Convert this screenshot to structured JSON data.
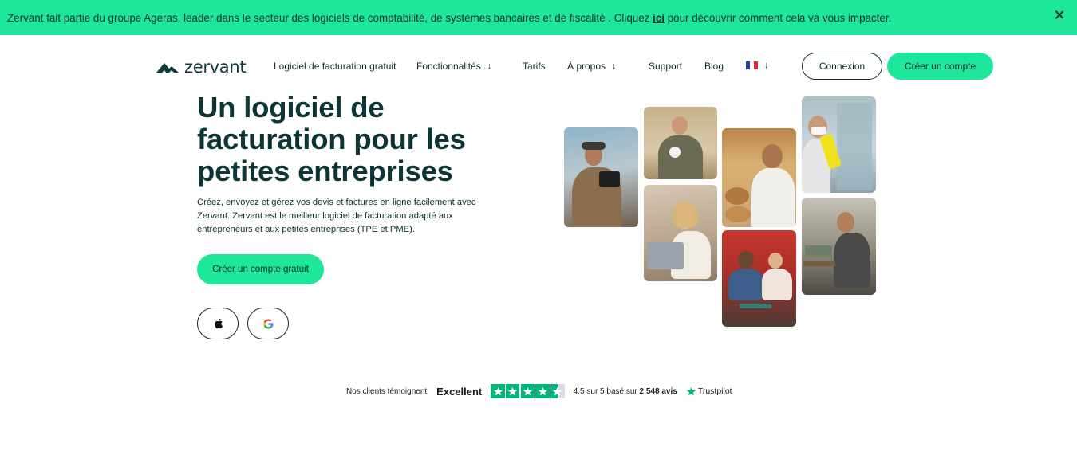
{
  "banner": {
    "text_before": "Zervant fait partie du groupe Ageras, leader dans le secteur des logiciels de comptabilité, de systèmes bancaires et de fiscalité . Cliquez ",
    "link": "ici",
    "text_after": " pour découvrir comment cela va vous impacter.",
    "background": "#1ee69a"
  },
  "logo": {
    "text": "zervant",
    "icon": "zervant-logo-icon",
    "color": "#0d3b3b"
  },
  "nav": {
    "items": [
      {
        "label": "Logiciel de facturation gratuit",
        "dropdown": false
      },
      {
        "label": "Fonctionnalités",
        "dropdown": true
      },
      {
        "label": "Tarifs",
        "dropdown": false
      },
      {
        "label": "À propos",
        "dropdown": true
      },
      {
        "label": "Support",
        "dropdown": false
      },
      {
        "label": "Blog",
        "dropdown": false
      }
    ],
    "language_icon": "france-flag-icon",
    "login_label": "Connexion",
    "signup_label": "Créer un compte"
  },
  "hero": {
    "title": "Un logiciel de facturation pour les petites entreprises",
    "description": "Créez, envoyez et gérez vos devis et factures en ligne facilement avec Zervant. Zervant est le meilleur logiciel de facturation adapté aux entrepreneurs et aux petites entreprises (TPE et PME).",
    "cta_label": "Créer un compte gratuit",
    "store_icons": [
      "apple-icon",
      "google-icon"
    ],
    "photos": [
      "photo-videographer",
      "photo-craftsman",
      "photo-woman-laptop",
      "photo-baker",
      "photo-cafe-couple",
      "photo-cleaner",
      "photo-repair-technician"
    ]
  },
  "trustpilot": {
    "intro": "Nos clients témoignent",
    "rating_word": "Excellent",
    "score_text": "4.5 sur 5 basé sur",
    "review_count": "2 548 avis",
    "brand": "Trustpilot",
    "stars": 4.5,
    "star_color": "#00b67a"
  },
  "colors": {
    "accent": "#1ee69a",
    "text": "#0d2b2b"
  }
}
